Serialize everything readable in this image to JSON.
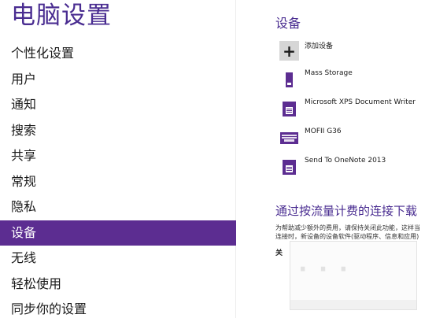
{
  "page": {
    "title": "电脑设置"
  },
  "nav": {
    "items": [
      "个性化设置",
      "用户",
      "通知",
      "搜索",
      "共享",
      "常规",
      "隐私",
      "设备",
      "无线",
      "轻松使用",
      "同步你的设置"
    ],
    "selected": "设备"
  },
  "devices": {
    "heading": "设备",
    "add_label": "添加设备",
    "items": [
      {
        "label": "Mass Storage",
        "icon": "usb-drive-icon"
      },
      {
        "label": "Microsoft XPS Document Writer",
        "icon": "printer-icon"
      },
      {
        "label": "MOFII G36",
        "icon": "keyboard-icon"
      },
      {
        "label": "Send To OneNote 2013",
        "icon": "printer-icon"
      }
    ]
  },
  "metered": {
    "heading": "通过按流量计费的连接下载",
    "desc_line1": "为帮助减少额外的费用，请保持关闭此功能，这样当",
    "desc_line2": "连接时，新设备的设备软件(驱动程序、信息和应用)",
    "toggle_state": "关"
  },
  "colors": {
    "accent": "#5c2d91",
    "title": "#4a2d91"
  }
}
